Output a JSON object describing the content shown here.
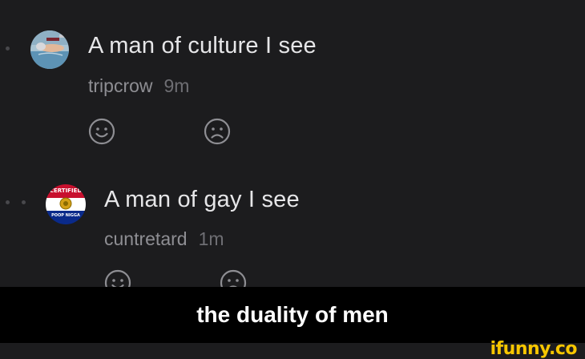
{
  "comments": [
    {
      "text": "A man of culture I see",
      "username": "tripcrow",
      "time": "9m",
      "avatar_icon": "swimmer-photo-avatar",
      "reactions": [
        "smile-icon",
        "frown-icon"
      ]
    },
    {
      "text": "A man of gay I see",
      "username": "cuntretard",
      "time": "1m",
      "avatar_icon": "certified-badge-avatar",
      "avatar_text": [
        "CERTIFIED",
        "POOP NIGGA"
      ],
      "reactions": [
        "smile-icon",
        "frown-icon"
      ]
    }
  ],
  "caption": "the duality of men",
  "watermark": "ifunny.co",
  "colors": {
    "background": "#1c1c1e",
    "text": "#e6e6e8",
    "muted": "#8e8e93",
    "caption_bar": "#000000",
    "watermark": "#f7c600"
  }
}
